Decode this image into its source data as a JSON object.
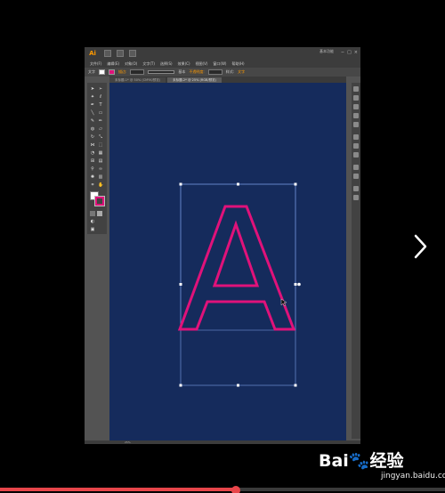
{
  "app": {
    "logo_text": "Ai",
    "workspace_label": "基本功能",
    "menus": [
      "文件(F)",
      "编辑(E)",
      "对象(O)",
      "文字(T)",
      "选择(S)",
      "效果(C)",
      "视图(V)",
      "窗口(W)",
      "帮助(H)"
    ]
  },
  "controlbar": {
    "object_label": "文字",
    "stroke_label": "描边:",
    "style_label": "基本",
    "opacity_label": "不透明度:",
    "style_btn": "样式:",
    "right_label": "文字"
  },
  "tabs": [
    {
      "label": "未标题-1* @ 50% (CMYK/预览)",
      "active": false
    },
    {
      "label": "未标题-2* @ 25% (RGB/预览)",
      "active": true
    }
  ],
  "status": {
    "zoom": "25%"
  },
  "colors": {
    "canvas": "#152b5c",
    "letter_stroke": "#e0127a",
    "selection": "#6f8fd6",
    "progress": "#e8454a"
  },
  "artwork": {
    "glyph": "A"
  },
  "icons": {
    "next": "chevron-right-icon"
  },
  "watermark": {
    "logo": "Bai🐾经验",
    "url": "jingyan.baidu.com"
  },
  "video": {
    "progress_fraction": 0.53
  }
}
